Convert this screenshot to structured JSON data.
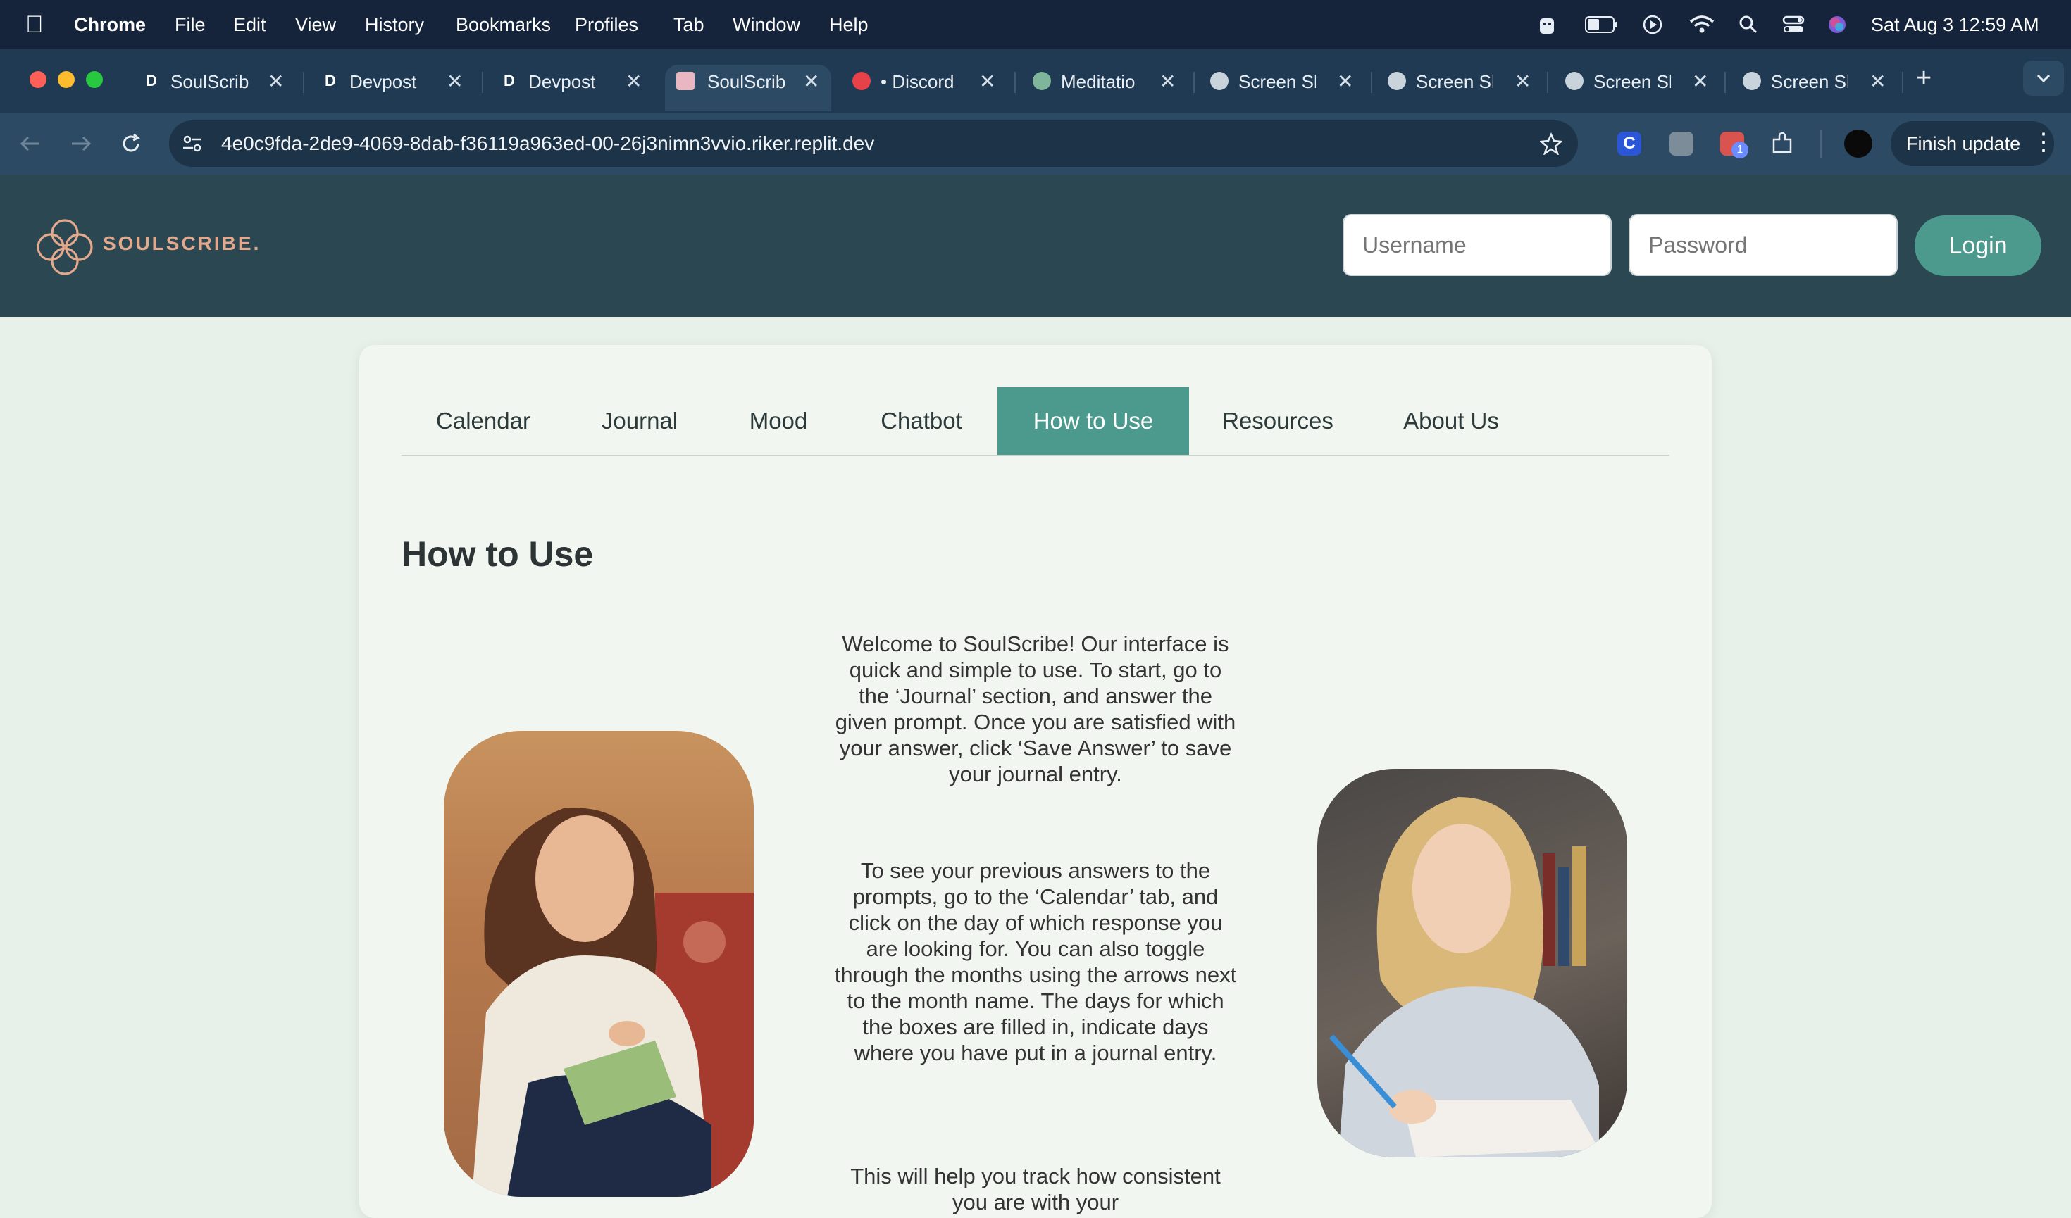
{
  "menubar": {
    "app": "Chrome",
    "items": [
      "File",
      "Edit",
      "View",
      "History",
      "Bookmarks",
      "Profiles",
      "Tab",
      "Window",
      "Help"
    ],
    "datetime": "Sat Aug 3  12:59 AM"
  },
  "tabs": [
    {
      "title": "SoulScrib",
      "icon": "devpost-icon"
    },
    {
      "title": "Devpost",
      "icon": "devpost-icon"
    },
    {
      "title": "Devpost",
      "icon": "devpost-icon"
    },
    {
      "title": "SoulScrib",
      "icon": "soulscribe-icon",
      "active": true
    },
    {
      "title": "• Discord",
      "icon": "discord-icon"
    },
    {
      "title": "Meditatio",
      "icon": "globe-icon"
    },
    {
      "title": "Screen Sh",
      "icon": "globe-icon"
    },
    {
      "title": "Screen Sh",
      "icon": "globe-icon"
    },
    {
      "title": "Screen Sh",
      "icon": "globe-icon"
    },
    {
      "title": "Screen Sh",
      "icon": "globe-icon"
    }
  ],
  "toolbar": {
    "url": "4e0c9fda-2de9-4069-8dab-f36119a963ed-00-26j3nimn3vvio.riker.replit.dev",
    "finish_update": "Finish update",
    "extension_badge": "1"
  },
  "header": {
    "brand": "SOULSCRIBE.",
    "username_placeholder": "Username",
    "password_placeholder": "Password",
    "login_label": "Login"
  },
  "nav": {
    "tabs": [
      "Calendar",
      "Journal",
      "Mood",
      "Chatbot",
      "How to Use",
      "Resources",
      "About Us"
    ],
    "active": "How to Use"
  },
  "content": {
    "title": "How to Use",
    "paragraphs": [
      "Welcome to SoulScribe! Our interface is quick and simple to use. To start, go to the ‘Journal’ section, and answer the given prompt. Once you are satisfied with your answer, click ‘Save Answer’ to save your journal entry.",
      "To see your previous answers to the prompts, go to the ‘Calendar’ tab, and click on the day of which response you are looking for. You can also toggle through the months using the arrows next to the month name. The days for which the boxes are filled in, indicate days where you have put in a journal entry.",
      "This will help you track how consistent you are with your"
    ]
  },
  "colors": {
    "accent": "#4c9a8d",
    "header_bg": "#2b4752",
    "page_bg": "#e7f1ea",
    "card_bg": "#f2f6f1"
  }
}
